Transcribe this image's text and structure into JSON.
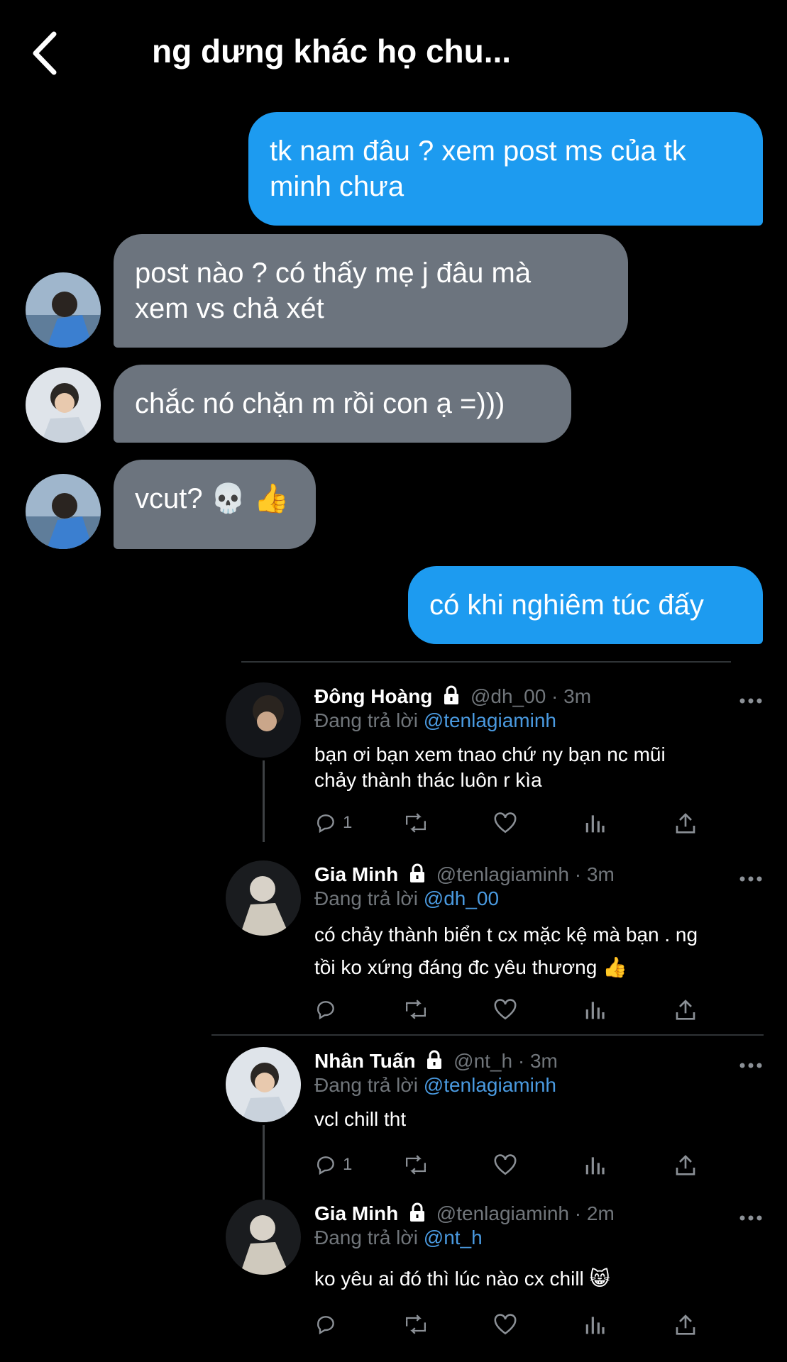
{
  "header": {
    "title": "ng dưng khác họ chu..."
  },
  "messages": [
    {
      "direction": "out",
      "lines": [
        "tk nam đâu ? xem post ms của tk",
        "minh chưa"
      ]
    },
    {
      "direction": "in",
      "lines": [
        "post nào ? có thấy mẹ j đâu mà",
        "xem vs chả xét"
      ]
    },
    {
      "direction": "in",
      "lines": [
        "chắc nó chặn m rồi con ạ =)))"
      ]
    },
    {
      "direction": "in",
      "lines": [
        "vcut? 💀 👍"
      ]
    },
    {
      "direction": "out",
      "lines": [
        "có khi nghiêm túc đấy"
      ]
    }
  ],
  "tweets": [
    {
      "name": "Đông Hoàng",
      "handle": "@dh_00 · 3m",
      "reply_prefix": "Đang trả lời ",
      "reply_to": "@tenlagiaminh",
      "lines": [
        "bạn ơi bạn xem tnao chứ ny bạn nc mũi",
        "chảy thành thác luôn r kìa"
      ],
      "reply_count": "1"
    },
    {
      "name": "Gia Minh",
      "handle": "@tenlagiaminh · 3m",
      "reply_prefix": "Đang trả lời ",
      "reply_to": "@dh_00",
      "lines": [
        "có chảy thành biển t cx mặc kệ mà bạn . ng",
        "tồi ko xứng đáng đc yêu thương 👍"
      ],
      "reply_count": ""
    },
    {
      "name": "Nhân Tuấn",
      "handle": "@nt_h · 3m",
      "reply_prefix": "Đang trả lời ",
      "reply_to": "@tenlagiaminh",
      "lines": [
        "vcl chill tht"
      ],
      "reply_count": "1"
    },
    {
      "name": "Gia Minh",
      "handle": "@tenlagiaminh · 2m",
      "reply_prefix": "Đang trả lời ",
      "reply_to": "@nt_h",
      "lines": [
        "ko yêu ai đó thì lúc nào cx chill 😸"
      ],
      "reply_count": ""
    }
  ],
  "colors": {
    "background": "#000000",
    "outgoing_bubble": "#1d9bf0",
    "incoming_bubble": "#6c747e",
    "mention": "#4a9ae0",
    "muted_text": "#71767b"
  }
}
